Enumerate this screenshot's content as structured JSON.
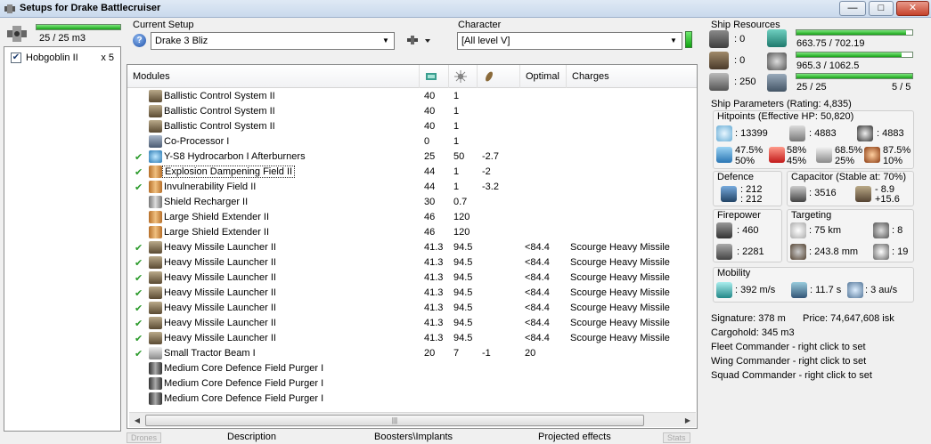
{
  "window": {
    "title": "Setups for Drake Battlecruiser",
    "min": "—",
    "max": "□",
    "close": "✕"
  },
  "drones": {
    "bay_value": "25 / 25 m3",
    "bay_fill": 1.0,
    "items": [
      {
        "name": "Hobgoblin II",
        "qty": "x 5",
        "checked": true
      }
    ]
  },
  "setup": {
    "label": "Current Setup",
    "value": "Drake 3 Bliz"
  },
  "character": {
    "label": "Character",
    "value": "[All level V]"
  },
  "modules": {
    "columns": [
      "Modules",
      "Optimal",
      "Charges"
    ],
    "rows": [
      {
        "check": "",
        "name": "Ballistic Control System II",
        "cpu": "40",
        "pg": "1",
        "cap": "",
        "optimal": "",
        "charges": "",
        "icon": "launcher"
      },
      {
        "check": "",
        "name": "Ballistic Control System II",
        "cpu": "40",
        "pg": "1",
        "cap": "",
        "optimal": "",
        "charges": "",
        "icon": "launcher"
      },
      {
        "check": "",
        "name": "Ballistic Control System II",
        "cpu": "40",
        "pg": "1",
        "cap": "",
        "optimal": "",
        "charges": "",
        "icon": "launcher"
      },
      {
        "check": "",
        "name": "Co-Processor I",
        "cpu": "0",
        "pg": "1",
        "cap": "",
        "optimal": "",
        "charges": "",
        "icon": "chip"
      },
      {
        "check": "✔",
        "name": "Y-S8 Hydrocarbon I Afterburners",
        "cpu": "25",
        "pg": "50",
        "cap": "-2.7",
        "optimal": "",
        "charges": "",
        "icon": "burner"
      },
      {
        "check": "✔",
        "name": "Explosion Dampening Field II",
        "cpu": "44",
        "pg": "1",
        "cap": "-2",
        "optimal": "",
        "charges": "",
        "icon": "shield",
        "selected": true
      },
      {
        "check": "✔",
        "name": "Invulnerability Field II",
        "cpu": "44",
        "pg": "1",
        "cap": "-3.2",
        "optimal": "",
        "charges": "",
        "icon": "shield"
      },
      {
        "check": "",
        "name": "Shield Recharger II",
        "cpu": "30",
        "pg": "0.7",
        "cap": "",
        "optimal": "",
        "charges": "",
        "icon": "shield-grey"
      },
      {
        "check": "",
        "name": "Large Shield Extender II",
        "cpu": "46",
        "pg": "120",
        "cap": "",
        "optimal": "",
        "charges": "",
        "icon": "shield"
      },
      {
        "check": "",
        "name": "Large Shield Extender II",
        "cpu": "46",
        "pg": "120",
        "cap": "",
        "optimal": "",
        "charges": "",
        "icon": "shield"
      },
      {
        "check": "✔",
        "name": "Heavy Missile Launcher II",
        "cpu": "41.3",
        "pg": "94.5",
        "cap": "",
        "optimal": "<84.4",
        "charges": "Scourge Heavy Missile",
        "icon": "launcher"
      },
      {
        "check": "✔",
        "name": "Heavy Missile Launcher II",
        "cpu": "41.3",
        "pg": "94.5",
        "cap": "",
        "optimal": "<84.4",
        "charges": "Scourge Heavy Missile",
        "icon": "launcher"
      },
      {
        "check": "✔",
        "name": "Heavy Missile Launcher II",
        "cpu": "41.3",
        "pg": "94.5",
        "cap": "",
        "optimal": "<84.4",
        "charges": "Scourge Heavy Missile",
        "icon": "launcher"
      },
      {
        "check": "✔",
        "name": "Heavy Missile Launcher II",
        "cpu": "41.3",
        "pg": "94.5",
        "cap": "",
        "optimal": "<84.4",
        "charges": "Scourge Heavy Missile",
        "icon": "launcher"
      },
      {
        "check": "✔",
        "name": "Heavy Missile Launcher II",
        "cpu": "41.3",
        "pg": "94.5",
        "cap": "",
        "optimal": "<84.4",
        "charges": "Scourge Heavy Missile",
        "icon": "launcher"
      },
      {
        "check": "✔",
        "name": "Heavy Missile Launcher II",
        "cpu": "41.3",
        "pg": "94.5",
        "cap": "",
        "optimal": "<84.4",
        "charges": "Scourge Heavy Missile",
        "icon": "launcher"
      },
      {
        "check": "✔",
        "name": "Heavy Missile Launcher II",
        "cpu": "41.3",
        "pg": "94.5",
        "cap": "",
        "optimal": "<84.4",
        "charges": "Scourge Heavy Missile",
        "icon": "launcher"
      },
      {
        "check": "✔",
        "name": "Small Tractor Beam I",
        "cpu": "20",
        "pg": "7",
        "cap": "-1",
        "optimal": "20",
        "charges": "",
        "icon": "tractor"
      },
      {
        "check": "",
        "name": "Medium Core Defence Field Purger I",
        "cpu": "",
        "pg": "",
        "cap": "",
        "optimal": "",
        "charges": "",
        "icon": "rig"
      },
      {
        "check": "",
        "name": "Medium Core Defence Field Purger I",
        "cpu": "",
        "pg": "",
        "cap": "",
        "optimal": "",
        "charges": "",
        "icon": "rig"
      },
      {
        "check": "",
        "name": "Medium Core Defence Field Purger I",
        "cpu": "",
        "pg": "",
        "cap": "",
        "optimal": "",
        "charges": "",
        "icon": "rig"
      }
    ]
  },
  "bottom_tabs": {
    "drones": "Drones",
    "description": "Description",
    "boosters": "Boosters\\Implants",
    "projected": "Projected effects",
    "stats": "Stats"
  },
  "resources": {
    "title": "Ship Resources",
    "turret": ": 0",
    "launcher": ": 0",
    "calibration": ": 250",
    "cpu": "663.75 / 702.19",
    "cpu_fill": 0.945,
    "powergrid": "965.3 / 1062.5",
    "pg_fill": 0.908,
    "drone_bw": "25 / 25",
    "drone_count": "5 / 5",
    "drone_fill": 1.0
  },
  "params": {
    "title": "Ship Parameters (Rating: 4,835)",
    "hitpoints": {
      "title": "Hitpoints (Effective HP: 50,820)",
      "shield": ": 13399",
      "armor": ": 4883",
      "structure": ": 4883",
      "em": [
        "47.5%",
        "50%"
      ],
      "thermal": [
        "58%",
        "45%"
      ],
      "kinetic": [
        "68.5%",
        "25%"
      ],
      "explosive": [
        "87.5%",
        "10%"
      ]
    },
    "defence": {
      "title": "Defence",
      "a": ": 212",
      "b": ": 212"
    },
    "capacitor": {
      "title": "Capacitor (Stable at: 70%)",
      "cap": ": 3516",
      "delta1": "- 8.9",
      "delta2": "+15.6"
    },
    "firepower": {
      "title": "Firepower",
      "volley": ": 460",
      "dps": ": 2281"
    },
    "targeting": {
      "title": "Targeting",
      "range": ": 75 km",
      "targets": ": 8",
      "scan": ": 243.8 mm",
      "sensor": ": 19"
    },
    "mobility": {
      "title": "Mobility",
      "speed": ": 392 m/s",
      "align": ": 11.7 s",
      "warp": ": 3 au/s"
    }
  },
  "info": {
    "signature": "Signature: 378 m",
    "price": "Price: 74,647,608 isk",
    "cargo": "Cargohold: 345 m3",
    "fleet": "Fleet Commander - right click to set",
    "wing": "Wing Commander - right click to set",
    "squad": "Squad Commander - right click to set"
  },
  "colors": {
    "accent_green": "#18a218",
    "check_green": "#2a9a2a"
  }
}
